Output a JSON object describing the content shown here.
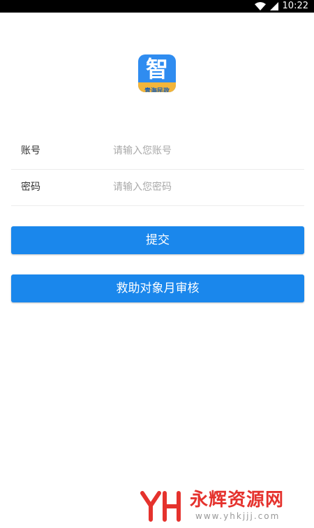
{
  "status_bar": {
    "time": "10:22",
    "icons": [
      "wifi-icon",
      "signal-icon"
    ]
  },
  "logo": {
    "glyph": "智",
    "ribbon_text": "青海民政",
    "colors": {
      "background": "#2f8cf0",
      "ribbon": "#f3b53a"
    }
  },
  "form": {
    "account": {
      "label": "账号",
      "placeholder": "请输入您账号",
      "value": ""
    },
    "password": {
      "label": "密码",
      "placeholder": "请输入您密码",
      "value": ""
    }
  },
  "buttons": {
    "submit_label": "提交",
    "audit_label": "救助对象月审核",
    "color": "#1a87ec"
  },
  "watermark": {
    "title": "永辉资源网",
    "url": "www.yhkjjj.com",
    "color": "#e5322d"
  }
}
